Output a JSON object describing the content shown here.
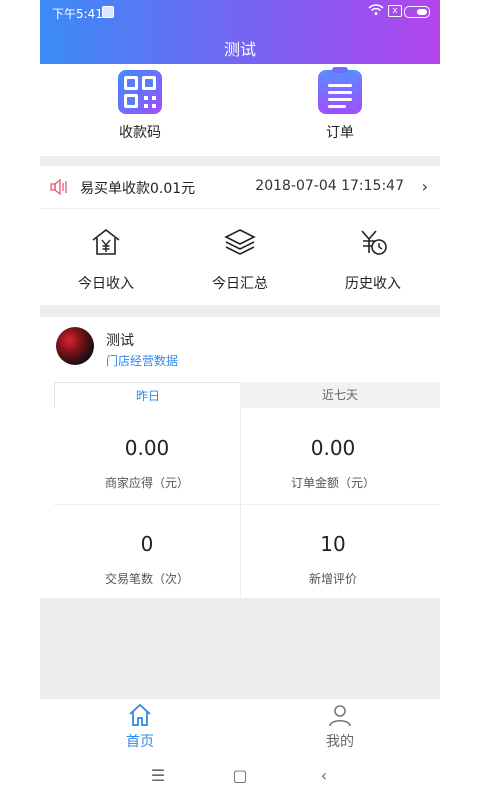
{
  "status_bar": {
    "time": "下午5:41",
    "battery_label": "x"
  },
  "header": {
    "title": "测试"
  },
  "quick_actions": [
    {
      "label": "收款码",
      "icon": "qr-code-icon"
    },
    {
      "label": "订单",
      "icon": "order-clipboard-icon"
    }
  ],
  "notice": {
    "text": "易买单收款0.01元",
    "timestamp": "2018-07-04 17:15:47",
    "icon": "speaker-icon",
    "chevron": "›"
  },
  "shortcuts": [
    {
      "label": "今日收入",
      "icon": "home-yuan-icon"
    },
    {
      "label": "今日汇总",
      "icon": "layers-icon"
    },
    {
      "label": "历史收入",
      "icon": "yuan-clock-icon"
    }
  ],
  "store": {
    "name": "测试",
    "subtitle": "门店经营数据"
  },
  "tabs": [
    {
      "label": "昨日",
      "active": true
    },
    {
      "label": "近七天",
      "active": false
    }
  ],
  "metrics": [
    {
      "value": "0.00",
      "label": "商家应得（元）"
    },
    {
      "value": "0.00",
      "label": "订单金额（元）"
    },
    {
      "value": "0",
      "label": "交易笔数（次）"
    },
    {
      "value": "10",
      "label": "新增评价"
    }
  ],
  "bottom_nav": [
    {
      "label": "首页",
      "icon": "home-icon",
      "active": true
    },
    {
      "label": "我的",
      "icon": "user-icon",
      "active": false
    }
  ],
  "system_nav": {
    "menu": "☰",
    "home": "▢",
    "back": "‹"
  },
  "colors": {
    "header_gradient_start": "#3a8cf5",
    "header_gradient_end": "#b446ee",
    "accent_blue": "#2f88ea",
    "speaker_red": "#e05a7a"
  }
}
